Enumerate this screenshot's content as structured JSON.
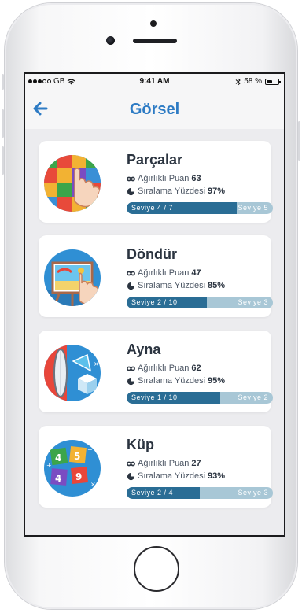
{
  "status_bar": {
    "carrier": "GB",
    "time": "9:41 AM",
    "battery": "58 %",
    "battery_level": 0.58
  },
  "nav": {
    "back_icon": "arrow-left-icon",
    "title": "Görsel"
  },
  "colors": {
    "accent": "#2d7bc4",
    "bar_fill": "#2a6d95",
    "bar_track": "#a8c7d6"
  },
  "cards": [
    {
      "title": "Parçalar",
      "icon": "puzzle-blocks-icon",
      "weighted_label": "Ağırlıklı Puan",
      "weighted_value": "63",
      "rank_label": "Sıralama Yüzdesi",
      "rank_value": "97%",
      "level_current": "Seviye  4 / 7",
      "level_next": "Seviye  5",
      "progress": 0.75
    },
    {
      "title": "Döndür",
      "icon": "easel-painting-icon",
      "weighted_label": "Ağırlıklı Puan",
      "weighted_value": "47",
      "rank_label": "Sıralama Yüzdesi",
      "rank_value": "85%",
      "level_current": "Seviye  2 / 10",
      "level_next": "Seviye  3",
      "progress": 0.55
    },
    {
      "title": "Ayna",
      "icon": "mirror-cube-icon",
      "weighted_label": "Ağırlıklı Puan",
      "weighted_value": "62",
      "rank_label": "Sıralama Yüzdesi",
      "rank_value": "95%",
      "level_current": "Seviye  1 / 10",
      "level_next": "Seviye  2",
      "progress": 0.64
    },
    {
      "title": "Küp",
      "icon": "number-cubes-icon",
      "weighted_label": "Ağırlıklı Puan",
      "weighted_value": "27",
      "rank_label": "Sıralama Yüzdesi",
      "rank_value": "93%",
      "level_current": "Seviye  2 / 4",
      "level_next": "Seviye  3",
      "progress": 0.5
    }
  ]
}
